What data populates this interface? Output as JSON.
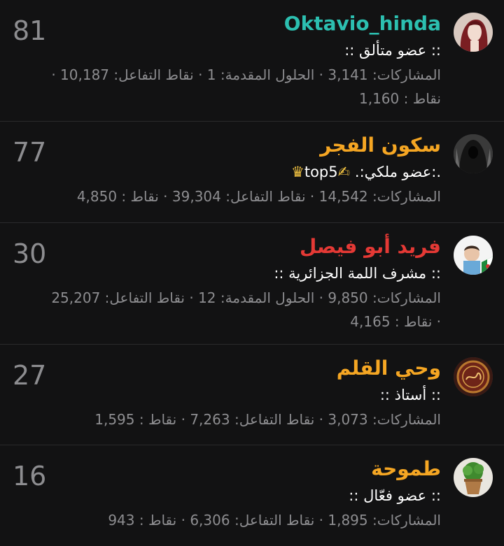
{
  "members": [
    {
      "score": "81",
      "username": "Oktavio_hinda",
      "username_color": "#2cbfb0",
      "title": ":: عضو متألق ::",
      "stats_line1": "المشاركات: 3,141 · الحلول المقدمة: 1 · نقاط التفاعل: 10,187 ·",
      "stats_line2": "نقاط : 1,160",
      "avatar": "woman-portrait-avatar"
    },
    {
      "score": "77",
      "username": "سكون الفجر",
      "username_color": "#f5a623",
      "title_prefix": ".:عضو ملكي:.",
      "title_suffix": "top5",
      "stats_line1": "المشاركات: 14,542 · نقاط التفاعل: 39,304 · نقاط : 4,850",
      "avatar": "hooded-figure-avatar"
    },
    {
      "score": "30",
      "username": "فريد أبو فيصل",
      "username_color": "#e53935",
      "title": ":: مشرف اللمة الجزائرية ::",
      "stats_line1": "المشاركات: 9,850 · الحلول المقدمة: 12 · نقاط التفاعل: 25,207",
      "stats_line2": "· نقاط : 4,165",
      "avatar": "child-with-flag-avatar"
    },
    {
      "score": "27",
      "username": "وحي القلم",
      "username_color": "#f5a623",
      "title": ":: أستاذ ::",
      "stats_line1": "المشاركات: 3,073 · نقاط التفاعل: 7,263 · نقاط : 1,595",
      "avatar": "calligraphy-emblem-avatar"
    },
    {
      "score": "16",
      "username": "طموحة",
      "username_color": "#f5a623",
      "title": ":: عضو فعّال ::",
      "stats_line1": "المشاركات: 1,895 · نقاط التفاعل: 6,306 · نقاط : 943",
      "avatar": "potted-plant-avatar"
    }
  ]
}
